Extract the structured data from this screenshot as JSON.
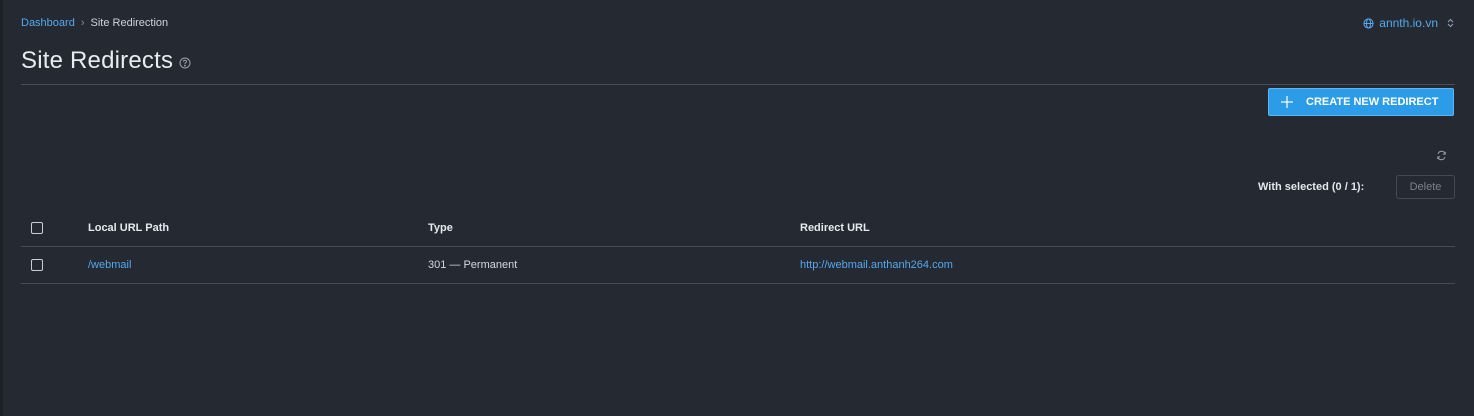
{
  "breadcrumb": {
    "home": "Dashboard",
    "current": "Site Redirection"
  },
  "site_switcher": {
    "domain": "annth.io.vn"
  },
  "page": {
    "title": "Site Redirects"
  },
  "toolbar": {
    "create_label": "CREATE NEW REDIRECT",
    "with_selected_label": "With selected (0 / 1):",
    "delete_label": "Delete"
  },
  "table": {
    "columns": [
      "Local URL Path",
      "Type",
      "Redirect URL"
    ],
    "rows": [
      {
        "path": "/webmail",
        "type": "301 — Permanent",
        "url": "http://webmail.anthanh264.com"
      }
    ]
  },
  "icons": {
    "site": "globe-icon",
    "site_toggle": "chevron-updown-icon",
    "help": "help-circle-icon",
    "create": "plus-icon",
    "refresh": "refresh-icon"
  },
  "colors": {
    "background": "#252932",
    "accent": "#2d9ce8",
    "link": "#54a9f0"
  }
}
